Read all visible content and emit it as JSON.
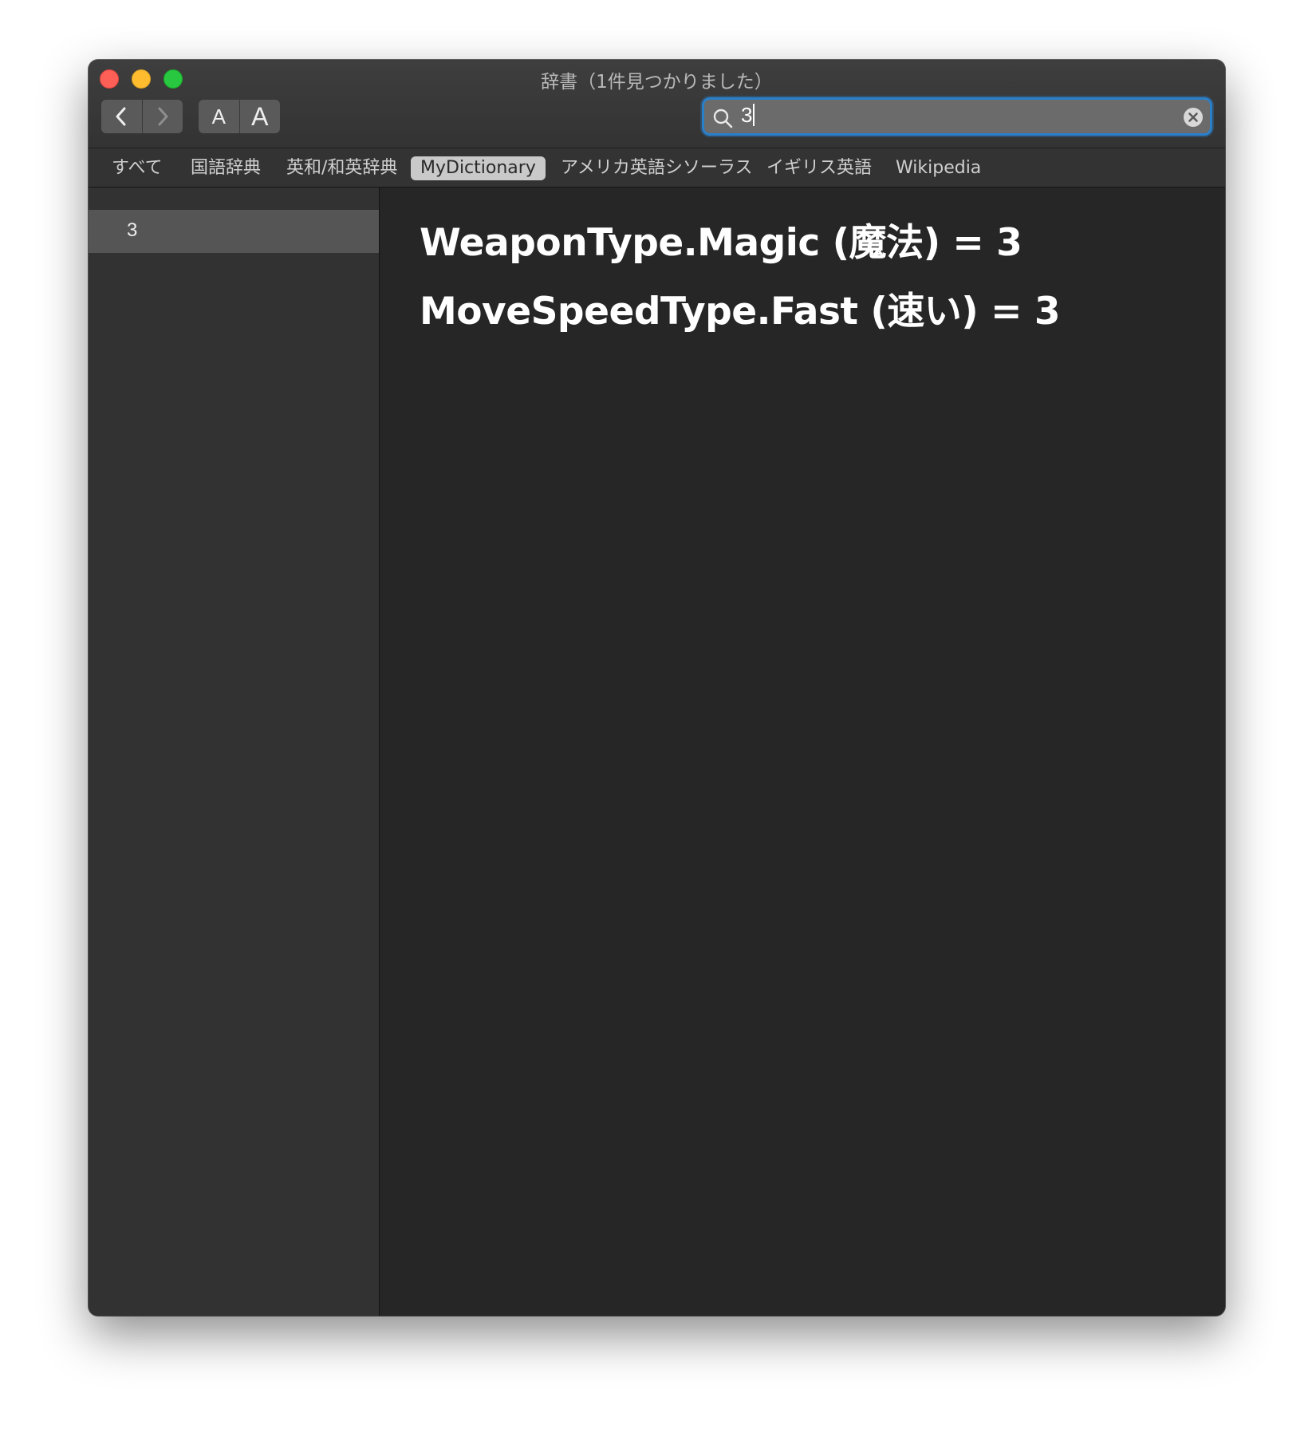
{
  "window": {
    "title": "辞書（1件見つかりました）"
  },
  "toolbar": {
    "back_icon": "chevron-left-icon",
    "forward_icon": "chevron-right-icon",
    "font_smaller_label": "A",
    "font_larger_label": "A"
  },
  "search": {
    "value": "3",
    "icon": "search-icon",
    "clear_icon": "clear-circle-icon",
    "focus_color": "#2a7fc9"
  },
  "tabs": [
    {
      "label": "すべて",
      "selected": false
    },
    {
      "label": "国語辞典",
      "selected": false
    },
    {
      "label": "英和/和英辞典",
      "selected": false
    },
    {
      "label": "MyDictionary",
      "selected": true
    },
    {
      "label": "アメリカ英語シソーラス",
      "selected": false
    },
    {
      "label": "イギリス英語",
      "selected": false
    },
    {
      "label": "Wikipedia",
      "selected": false
    }
  ],
  "sidebar": {
    "results": [
      {
        "label": "3",
        "selected": true
      }
    ]
  },
  "entries": [
    {
      "text": "WeaponType.Magic (魔法) = 3"
    },
    {
      "text": "MoveSpeedType.Fast (速い) = 3"
    }
  ],
  "colors": {
    "close": "#fe5f57",
    "minimize": "#febc2e",
    "maximize": "#28c840"
  }
}
